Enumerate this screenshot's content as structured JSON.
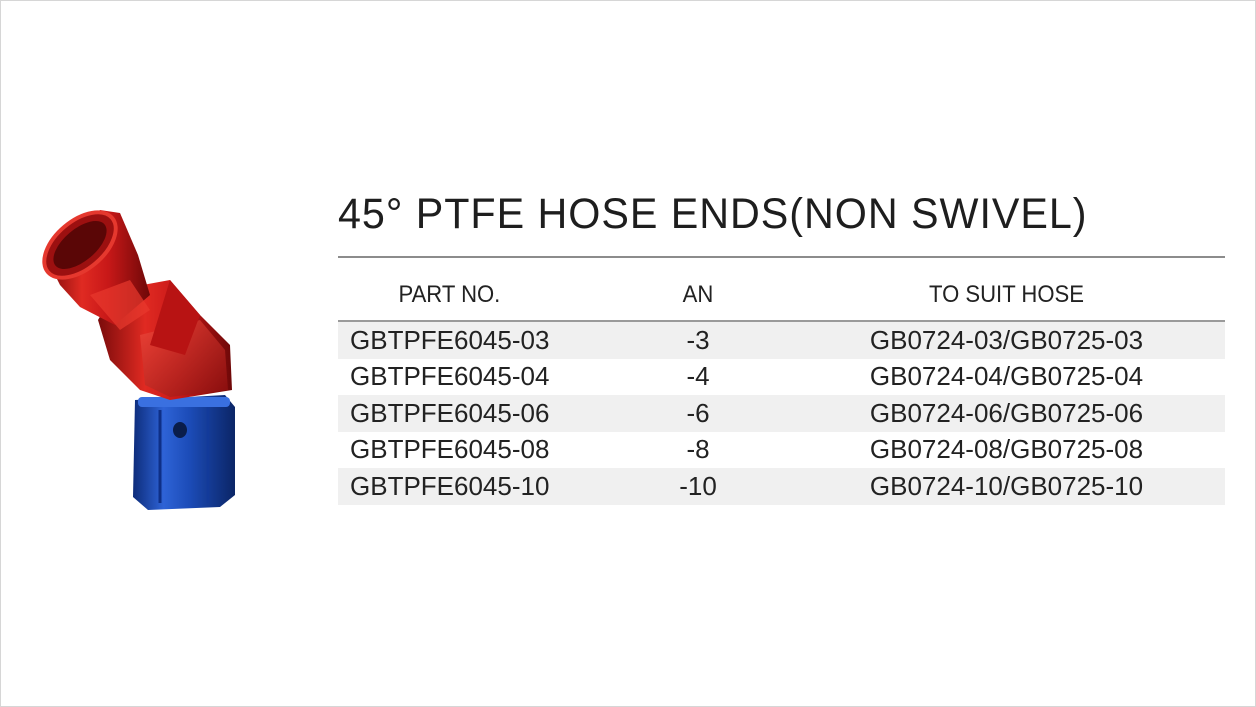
{
  "title": "45° PTFE HOSE ENDS(NON SWIVEL)",
  "table": {
    "headers": [
      "PART NO.",
      "AN",
      "TO SUIT HOSE"
    ],
    "rows": [
      [
        "GBTPFE6045-03",
        "-3",
        "GB0724-03/GB0725-03"
      ],
      [
        "GBTPFE6045-04",
        "-4",
        "GB0724-04/GB0725-04"
      ],
      [
        "GBTPFE6045-06",
        "-6",
        "GB0724-06/GB0725-06"
      ],
      [
        "GBTPFE6045-08",
        "-8",
        "GB0724-08/GB0725-08"
      ],
      [
        "GBTPFE6045-10",
        "-10",
        "GB0724-10/GB0725-10"
      ]
    ]
  },
  "colors": {
    "fitting_body": "#d21a1a",
    "fitting_nut": "#1f4fbf",
    "rule": "#8c8c8c",
    "row_stripe": "#f0f0f0"
  },
  "icons": {
    "product": "hose-end-fitting-illustration"
  }
}
